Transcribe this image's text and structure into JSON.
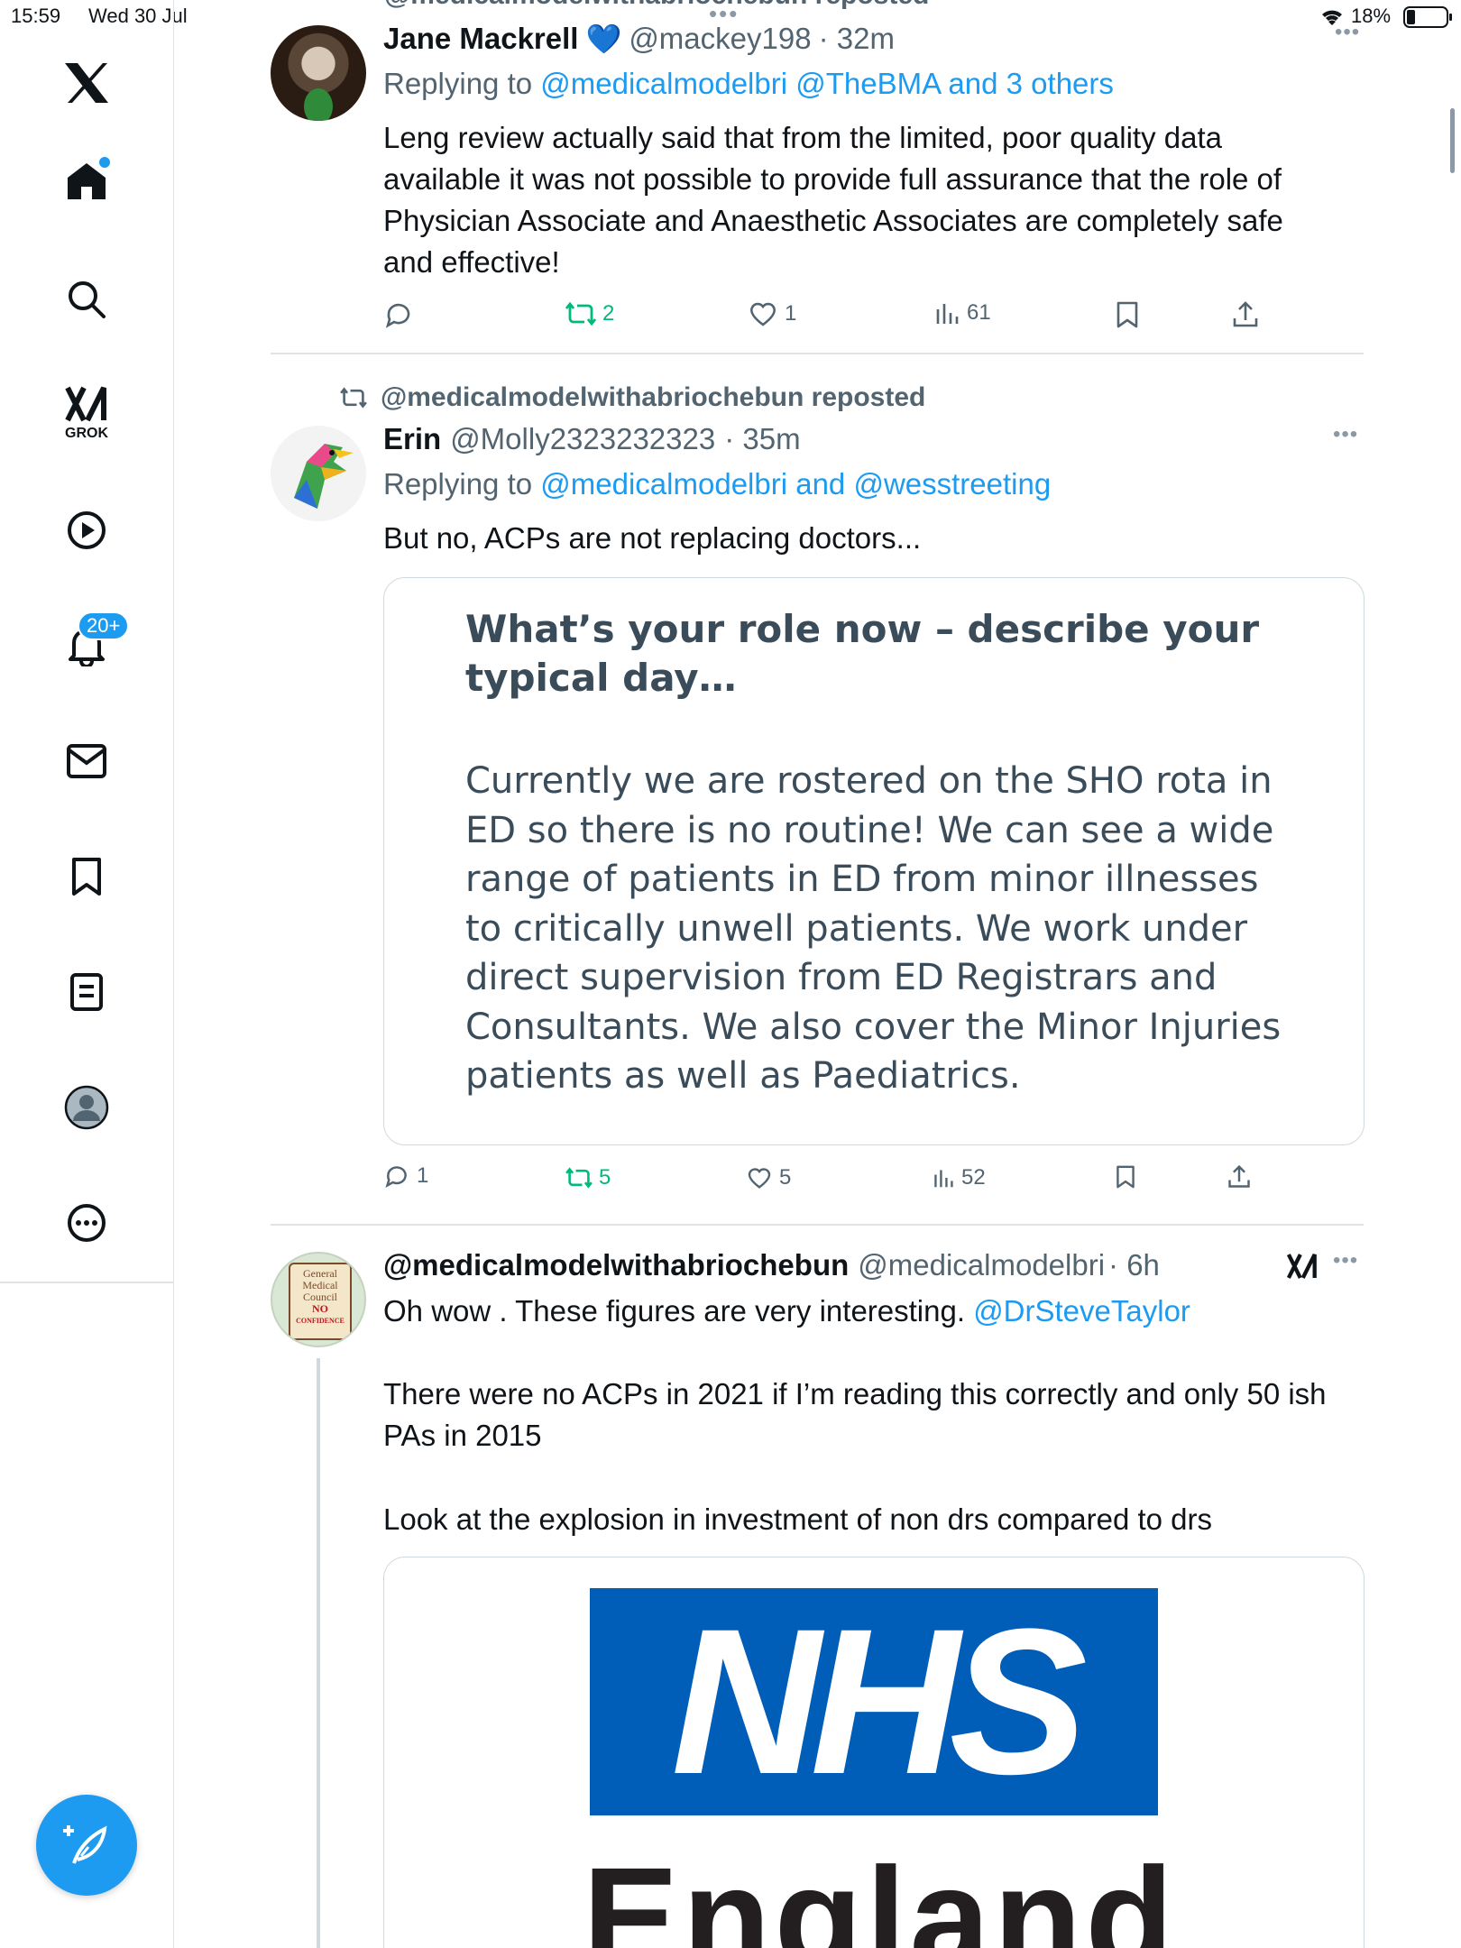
{
  "status_bar": {
    "time": "15:59",
    "date": "Wed 30 Jul",
    "battery": "18%"
  },
  "sidebar": {
    "grok_label": "GROK",
    "notifications_badge": "20+"
  },
  "top_repost": {
    "text": "@medicalmodelwithabriochebun reposted"
  },
  "tweets": [
    {
      "name": "Jane Mackrell",
      "emoji": "💙",
      "handle": "@mackey198",
      "time": "· 32m",
      "reply_prefix": "Replying to",
      "reply_targets": "@medicalmodelbri @TheBMA and 3 others",
      "text": [
        "Leng review actually said that from the limited, poor quality data",
        "available it was not possible to provide full assurance that the role of",
        "Physician Associate and Anaesthetic Associates are completely safe",
        "and effective!"
      ],
      "reposts": "2",
      "likes": "1",
      "views": "61"
    },
    {
      "repost_label": "@medicalmodelwithabriochebun reposted",
      "name": "Erin",
      "handle": "@Molly2323232323",
      "time": "· 35m",
      "reply_prefix": "Replying to",
      "reply_targets": "@medicalmodelbri and @wesstreeting",
      "text": "But no, ACPs are not replacing doctors...",
      "card_heading": [
        "What’s your role now – describe your",
        "typical day…"
      ],
      "card_body": [
        "Currently we are rostered on the SHO rota in",
        "ED so there is no routine! We can see a wide",
        "range of patients in ED from minor illnesses",
        "to critically unwell patients. We work under",
        "direct supervision from ED Registrars and",
        "Consultants. We also cover the Minor Injuries",
        "patients as well as Paediatrics."
      ],
      "replies": "1",
      "reposts": "5",
      "likes": "5",
      "views": "52"
    },
    {
      "name": "@medicalmodelwithabriochebun",
      "handle": "@medicalmodelbri",
      "time": "· 6h",
      "text_line1": "Oh wow . These figures are very interesting.",
      "mention": "@DrSteveTaylor",
      "text_para2": [
        "There were no ACPs in 2021 if I’m reading this correctly and only 50 ish",
        "PAs in 2015"
      ],
      "text_para3": "Look at the explosion in investment of non drs compared to drs",
      "image_logo": "NHS",
      "image_sub": "England",
      "avatar_text": [
        "General",
        "Medical",
        "Council",
        "NO",
        "CONFIDENCE"
      ]
    }
  ],
  "colors": {
    "accent": "#1d9bf0",
    "repost_green": "#00ba7c",
    "nhs_blue": "#005eb8"
  }
}
